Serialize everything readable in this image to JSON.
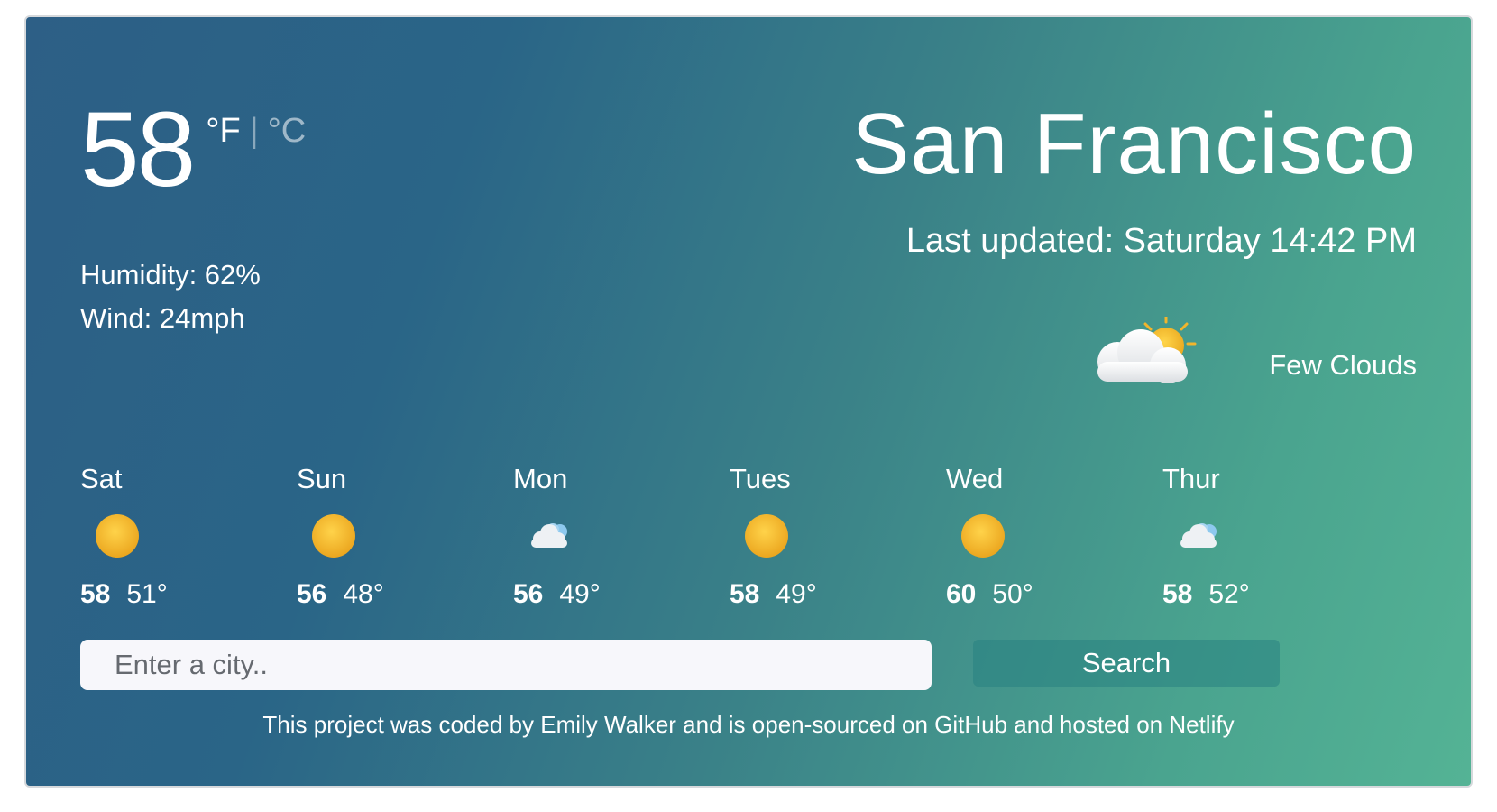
{
  "current": {
    "temperature": "58",
    "unit_f": "°F",
    "unit_separator": "|",
    "unit_c": "°C",
    "humidity": "Humidity: 62%",
    "wind": "Wind: 24mph",
    "city": "San Francisco",
    "last_updated": "Last updated: Saturday 14:42 PM",
    "condition": "Few Clouds",
    "icon": "few-clouds-icon"
  },
  "forecast": [
    {
      "day": "Sat",
      "high": "58",
      "low": "51°",
      "icon": "sun-icon"
    },
    {
      "day": "Sun",
      "high": "56",
      "low": "48°",
      "icon": "sun-icon"
    },
    {
      "day": "Mon",
      "high": "56",
      "low": "49°",
      "icon": "cloud-icon"
    },
    {
      "day": "Tues",
      "high": "58",
      "low": "49°",
      "icon": "sun-icon"
    },
    {
      "day": "Wed",
      "high": "60",
      "low": "50°",
      "icon": "sun-icon"
    },
    {
      "day": "Thur",
      "high": "58",
      "low": "52°",
      "icon": "cloud-icon"
    }
  ],
  "search": {
    "placeholder": "Enter a city..",
    "button_label": "Search"
  },
  "footer": {
    "part1": "This project was ",
    "coded_link": "coded",
    "part2": " by Emily Walker and is ",
    "opensource_link": "open-sourced on GitHub",
    "part3": " and ",
    "hosted_link": "hosted on Netlify"
  },
  "colors": {
    "gradient_start": "#2d5f86",
    "gradient_end": "#54b395",
    "sun": "#f0b92e",
    "search_button": "#3f8f8c"
  }
}
